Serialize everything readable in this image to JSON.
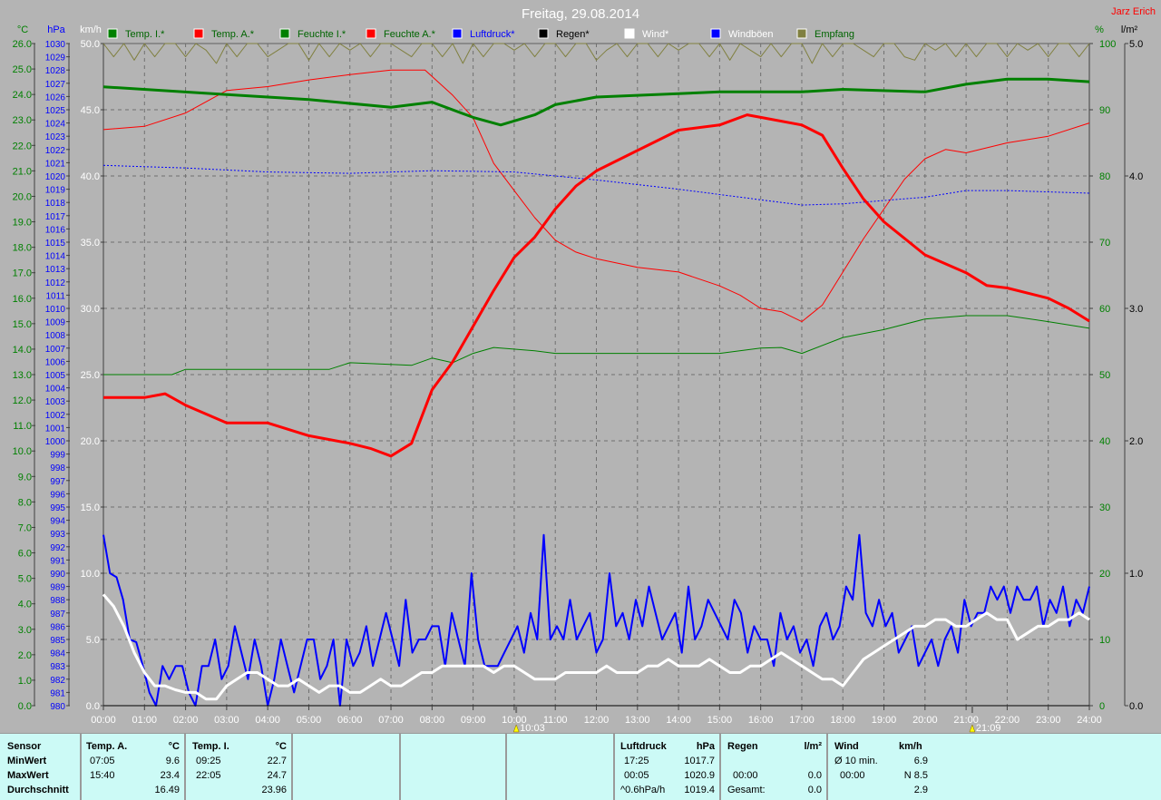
{
  "header": {
    "title": "Freitag, 29.08.2014",
    "author": "Jarz Erich"
  },
  "legend": [
    {
      "label": "Temp. I.*",
      "swatch": "#008000",
      "text_color": "#006400"
    },
    {
      "label": "Temp. A.*",
      "swatch": "#ff0000",
      "text_color": "#006400"
    },
    {
      "label": "Feuchte I.*",
      "swatch": "#008000",
      "text_color": "#006400"
    },
    {
      "label": "Feuchte A.*",
      "swatch": "#ff0000",
      "text_color": "#006400"
    },
    {
      "label": "Luftdruck*",
      "swatch": "#0000ff",
      "text_color": "#0000ff"
    },
    {
      "label": "Regen*",
      "swatch": "#000000",
      "text_color": "#000000"
    },
    {
      "label": "Wind*",
      "swatch": "#ffffff",
      "text_color": "#ffffff"
    },
    {
      "label": "Windböen",
      "swatch": "#0000ff",
      "text_color": "#ffffff"
    },
    {
      "label": "Empfang",
      "swatch": "#808040",
      "text_color": "#006400"
    }
  ],
  "chart_data": {
    "type": "line",
    "title": "Freitag, 29.08.2014",
    "x_range_hours": [
      0,
      24
    ],
    "x_ticks": [
      "00:00",
      "01:00",
      "02:00",
      "03:00",
      "04:00",
      "05:00",
      "06:00",
      "07:00",
      "08:00",
      "09:00",
      "10:00",
      "11:00",
      "12:00",
      "13:00",
      "14:00",
      "15:00",
      "16:00",
      "17:00",
      "18:00",
      "19:00",
      "20:00",
      "21:00",
      "22:00",
      "23:00",
      "24:00"
    ],
    "axes": {
      "temp": {
        "unit": "°C",
        "range": [
          0,
          26
        ],
        "step": 1,
        "color": "#008000"
      },
      "pressure": {
        "unit": "hPa",
        "range": [
          980,
          1030
        ],
        "step": 1,
        "color": "#0000ff"
      },
      "wind": {
        "unit": "km/h",
        "range": [
          0,
          50
        ],
        "step": 5,
        "color": "#ffffff"
      },
      "humidity": {
        "unit": "%",
        "range": [
          0,
          100
        ],
        "step": 10,
        "color": "#008000"
      },
      "rain": {
        "unit": "l/m²",
        "range": [
          0,
          5
        ],
        "step": 1,
        "color": "#000000"
      }
    },
    "markers": [
      {
        "label": "10:03",
        "hour": 10.05,
        "kind": "sunrise"
      },
      {
        "label": "21:09",
        "hour": 21.15,
        "kind": "sunset"
      }
    ],
    "series": [
      {
        "name": "Feuchte A.",
        "axis": "humidity",
        "color": "#ff0000",
        "width": 1,
        "x": [
          0,
          1,
          2,
          3,
          4,
          5,
          6,
          7,
          7.83,
          8.5,
          9,
          9.5,
          10,
          10.5,
          11,
          11.5,
          12,
          13,
          14,
          15,
          15.5,
          16,
          16.5,
          17,
          17.5,
          18,
          18.5,
          19,
          19.5,
          20,
          20.5,
          21,
          22,
          23,
          24
        ],
        "y": [
          87,
          87.5,
          89.5,
          92.9,
          93.5,
          94.5,
          95.3,
          96,
          96,
          92.2,
          88.8,
          81.9,
          77.8,
          73.7,
          70.3,
          68.5,
          67.5,
          66.2,
          65.5,
          63.4,
          62,
          60,
          59.5,
          58,
          60.5,
          65.5,
          70.5,
          75,
          79.5,
          82.6,
          84,
          83.5,
          85,
          86,
          88
        ]
      },
      {
        "name": "Feuchte I.",
        "axis": "humidity",
        "color": "#008000",
        "width": 1,
        "x": [
          0,
          1.67,
          2,
          5.5,
          6,
          7.5,
          8,
          8.5,
          9,
          9.5,
          10.5,
          11,
          15,
          16,
          16.5,
          17,
          18,
          19,
          20,
          21,
          22,
          23,
          24
        ],
        "y": [
          50,
          50,
          50.8,
          50.8,
          51.8,
          51.4,
          52.5,
          51.8,
          53.2,
          54.1,
          53.6,
          53.2,
          53.2,
          54,
          54.1,
          53.2,
          55.6,
          56.8,
          58.4,
          58.9,
          58.9,
          58,
          57
        ]
      },
      {
        "name": "Luftdruck",
        "axis": "pressure",
        "color": "#0000ff",
        "width": 1,
        "dashed": true,
        "x": [
          0,
          2,
          4,
          6,
          8,
          10,
          12,
          14,
          16,
          17,
          18,
          20,
          21,
          22,
          24
        ],
        "y": [
          1020.8,
          1020.6,
          1020.3,
          1020.2,
          1020.4,
          1020.3,
          1019.7,
          1019.0,
          1018.2,
          1017.8,
          1017.9,
          1018.4,
          1018.9,
          1018.9,
          1018.7
        ]
      },
      {
        "name": "Temp. I.",
        "axis": "temp",
        "color": "#008000",
        "width": 3,
        "x": [
          0,
          3,
          5,
          7,
          8,
          9,
          9.67,
          10.5,
          11,
          12,
          15,
          17,
          18,
          20,
          21,
          22,
          23,
          24
        ],
        "y": [
          24.3,
          24.0,
          23.8,
          23.5,
          23.7,
          23.1,
          22.8,
          23.2,
          23.6,
          23.9,
          24.1,
          24.1,
          24.2,
          24.1,
          24.4,
          24.6,
          24.6,
          24.5
        ]
      },
      {
        "name": "Temp. A.",
        "axis": "temp",
        "color": "#ff0000",
        "width": 3,
        "x": [
          0,
          1,
          1.5,
          2,
          3,
          4,
          5,
          6,
          6.5,
          7,
          7.5,
          8,
          8.5,
          9,
          9.5,
          10,
          10.5,
          11,
          11.5,
          12,
          13,
          14,
          15,
          15.67,
          16,
          17,
          17.5,
          18,
          18.5,
          19,
          20,
          21,
          21.5,
          22,
          23,
          23.5,
          24
        ],
        "y": [
          12.1,
          12.1,
          12.25,
          11.8,
          11.1,
          11.1,
          10.6,
          10.3,
          10.1,
          9.8,
          10.3,
          12.4,
          13.5,
          14.9,
          16.3,
          17.6,
          18.4,
          19.5,
          20.4,
          21.0,
          21.8,
          22.6,
          22.8,
          23.2,
          23.1,
          22.8,
          22.4,
          21.1,
          19.9,
          19.0,
          17.7,
          17.0,
          16.5,
          16.4,
          16.0,
          15.6,
          15.1
        ]
      },
      {
        "name": "Windböen",
        "axis": "wind",
        "color": "#0000ff",
        "width": 2,
        "y": [
          12.9,
          10,
          9.7,
          8,
          5,
          4.8,
          3,
          1,
          0,
          3,
          2,
          3,
          3,
          1,
          0,
          3,
          3,
          5,
          2,
          3,
          6,
          4,
          2,
          5,
          3,
          0,
          2,
          5,
          3,
          1,
          3,
          5,
          5,
          2,
          3,
          5,
          0,
          5,
          3,
          4,
          6,
          3,
          5,
          7,
          5,
          3,
          8,
          4,
          5,
          5,
          6,
          6,
          3,
          7,
          5,
          3,
          10,
          5,
          3,
          3,
          3,
          4,
          5,
          6,
          4,
          7,
          5,
          12.9,
          5,
          6,
          5,
          8,
          5,
          6,
          7,
          4,
          5,
          10,
          6,
          7,
          5,
          8,
          6,
          9,
          7,
          5,
          6,
          7,
          4,
          9,
          5,
          6,
          8,
          7,
          6,
          5,
          8,
          7,
          4,
          6,
          5,
          5,
          3,
          7,
          5,
          6,
          4,
          5,
          3,
          6,
          7,
          5,
          6,
          9,
          8,
          12.9,
          7,
          6,
          8,
          6,
          7,
          4,
          5,
          6,
          3,
          4,
          5,
          3,
          5,
          6,
          4,
          8,
          6,
          7,
          7,
          9,
          8,
          9,
          7,
          9,
          8,
          8,
          9,
          6,
          8,
          7,
          9,
          6,
          8,
          7,
          9
        ]
      },
      {
        "name": "Wind",
        "axis": "wind",
        "color": "#ffffff",
        "width": 3,
        "y": [
          8.4,
          7.5,
          6,
          4,
          2.5,
          1.5,
          1.5,
          1.2,
          1,
          1,
          0.5,
          0.5,
          1.5,
          2,
          2.5,
          2.5,
          2,
          1.5,
          1.5,
          2,
          1.5,
          1,
          1.5,
          1.5,
          1,
          1,
          1.5,
          2,
          1.5,
          1.5,
          2,
          2.5,
          2.5,
          3,
          3,
          3,
          3,
          3,
          2.5,
          3,
          3,
          2.5,
          2,
          2,
          2,
          2.5,
          2.5,
          2.5,
          2.5,
          3,
          2.5,
          2.5,
          2.5,
          3,
          3,
          3.5,
          3,
          3,
          3,
          3.5,
          3,
          2.5,
          2.5,
          3,
          3,
          3.5,
          4,
          3.5,
          3,
          2.5,
          2,
          2,
          1.5,
          2.5,
          3.5,
          4,
          4.5,
          5,
          5.5,
          6,
          6,
          6.5,
          6.5,
          6,
          6,
          6.5,
          7,
          6.5,
          6.5,
          5,
          5.5,
          6,
          6,
          6.5,
          6.5,
          7,
          6.5
        ]
      },
      {
        "name": "Empfang",
        "axis": "humidity",
        "color": "#808040",
        "width": 1,
        "y": [
          100,
          98,
          100,
          97.5,
          100,
          98,
          100,
          100,
          98,
          100,
          99,
          97,
          100,
          98,
          100,
          100,
          98,
          99,
          100,
          100,
          97.5,
          100,
          98,
          100,
          99,
          100,
          98,
          100,
          100,
          99,
          98,
          100,
          100,
          98,
          100,
          97,
          100,
          98,
          100,
          100,
          99,
          100,
          98,
          100,
          100,
          98,
          100,
          100,
          97.5,
          99,
          100,
          98,
          100,
          100,
          98,
          100,
          99,
          100,
          100,
          98,
          100,
          97.5,
          100,
          99,
          98,
          100,
          98,
          100,
          100,
          97,
          100,
          98,
          100,
          100,
          99,
          98,
          100,
          100,
          98,
          97.5,
          100,
          99,
          100,
          98,
          100,
          98,
          100,
          100,
          98,
          100,
          99,
          100,
          98,
          100,
          100,
          98,
          100
        ]
      }
    ]
  },
  "stats": {
    "sensor": {
      "header": "Sensor",
      "rows": [
        "MinWert",
        "MaxWert",
        "Durchschnitt"
      ]
    },
    "temp_a": {
      "header": "Temp. A.",
      "unit": "°C",
      "min_time": "07:05",
      "min": "9.6",
      "max_time": "15:40",
      "max": "23.4",
      "avg": "16.49"
    },
    "temp_i": {
      "header": "Temp. I.",
      "unit": "°C",
      "min_time": "09:25",
      "min": "22.7",
      "max_time": "22:05",
      "max": "24.7",
      "avg": "23.96"
    },
    "pressure": {
      "header": "Luftdruck",
      "unit": "hPa",
      "min_time": "17:25",
      "min": "1017.7",
      "max_time": "00:05",
      "max": "1020.9",
      "trend": "^0.6hPa/h",
      "avg": "1019.4"
    },
    "rain": {
      "header": "Regen",
      "unit": "l/m²",
      "max_time": "00:00",
      "max": "0.0",
      "total_label": "Gesamt:",
      "total": "0.0"
    },
    "wind": {
      "header": "Wind",
      "unit": "km/h",
      "avg10_label": "Ø 10 min.",
      "avg10": "6.9",
      "max_time": "00:00",
      "max": "N 8.5",
      "avg": "2.9"
    }
  }
}
